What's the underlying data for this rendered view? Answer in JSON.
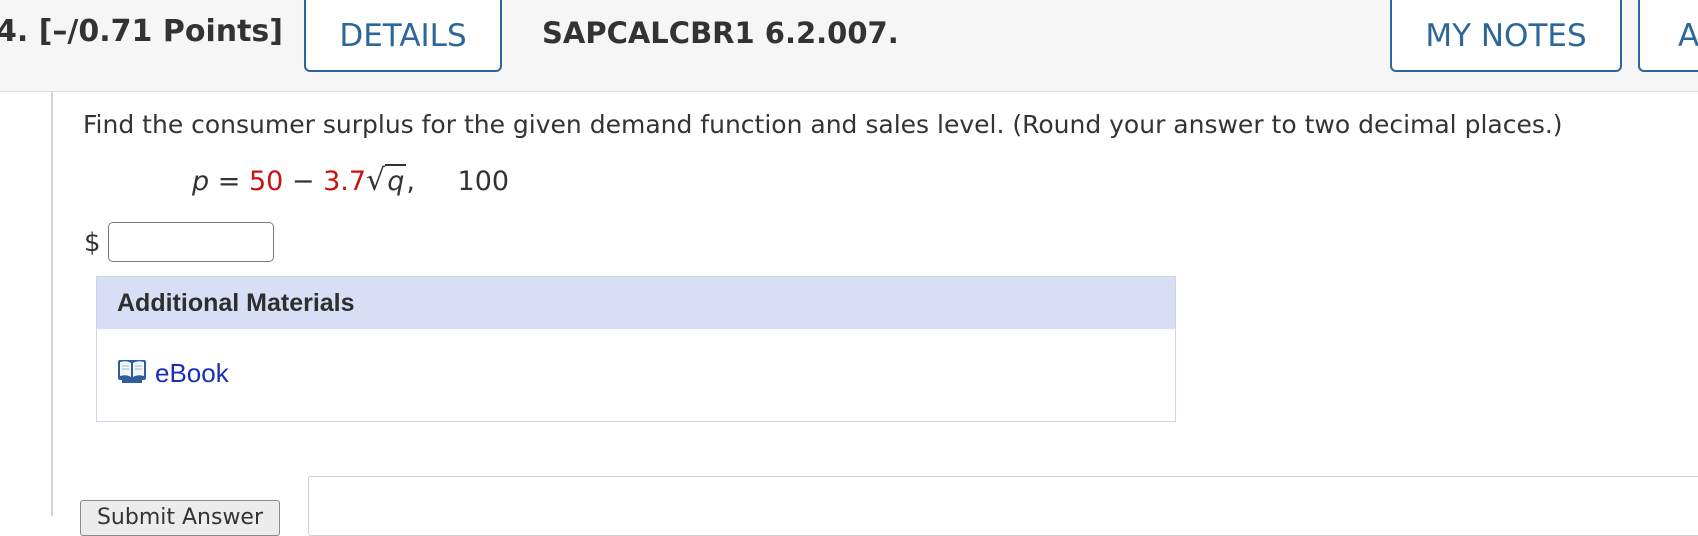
{
  "header": {
    "points": "4. [–/0.71 Points]",
    "details_label": "DETAILS",
    "question_id": "SAPCALCBR1 6.2.007.",
    "my_notes_label": "MY NOTES",
    "ask_label": "A"
  },
  "question": {
    "prompt": "Find the consumer surplus for the given demand function and sales level. (Round your answer to two decimal places.)",
    "equation": {
      "lhs": "p",
      "equals": "=",
      "constant": "50",
      "minus": "−",
      "coefficient": "3.7",
      "radical": "√",
      "radicand": "q",
      "comma": ",",
      "sales_level": "100"
    },
    "currency_symbol": "$",
    "answer_value": ""
  },
  "additional_materials": {
    "title": "Additional Materials",
    "ebook_label": "eBook"
  },
  "actions": {
    "submit_label": "Submit Answer"
  },
  "colors": {
    "accent": "#2d6799",
    "highlight_red": "#cc1111",
    "materials_header": "#d8def5",
    "link": "#1a2fb5"
  }
}
